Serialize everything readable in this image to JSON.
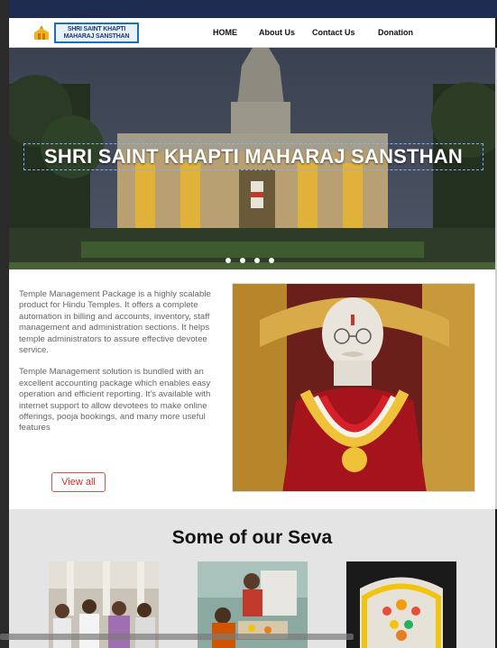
{
  "logo": {
    "line1": "SHRI SAINT KHAPTI",
    "line2": "MAHARAJ SANSTHAN"
  },
  "nav": [
    {
      "label": "HOME"
    },
    {
      "label": "About Us"
    },
    {
      "label": "Contact Us"
    },
    {
      "label": "Donation"
    }
  ],
  "hero": {
    "title": "SHRI SAINT KHAPTI MAHARAJ SANSTHAN",
    "slide_count": 4
  },
  "about": {
    "paragraph1": "Temple Management Package is a highly scalable product for Hindu Temples. It offers a complete automation in billing and accounts, inventory, staff management and administration sections. It helps temple administrators to assure effective devotee service.",
    "paragraph2": "Temple Management solution is bundled with an excellent accounting package which enables easy operation and efficient reporting. It's available with internet support to allow devotees to make online offerings, pooja bookings, and many more useful features",
    "button": "View all"
  },
  "seva": {
    "title": "Some of our Seva",
    "cards": [
      {
        "icon": "gathering-photo"
      },
      {
        "icon": "pooja-photo"
      },
      {
        "icon": "flower-decoration-photo"
      }
    ]
  },
  "colors": {
    "topbar": "#1f2c52",
    "button_border": "#d9534f",
    "logo_border": "#1d6fb8"
  }
}
